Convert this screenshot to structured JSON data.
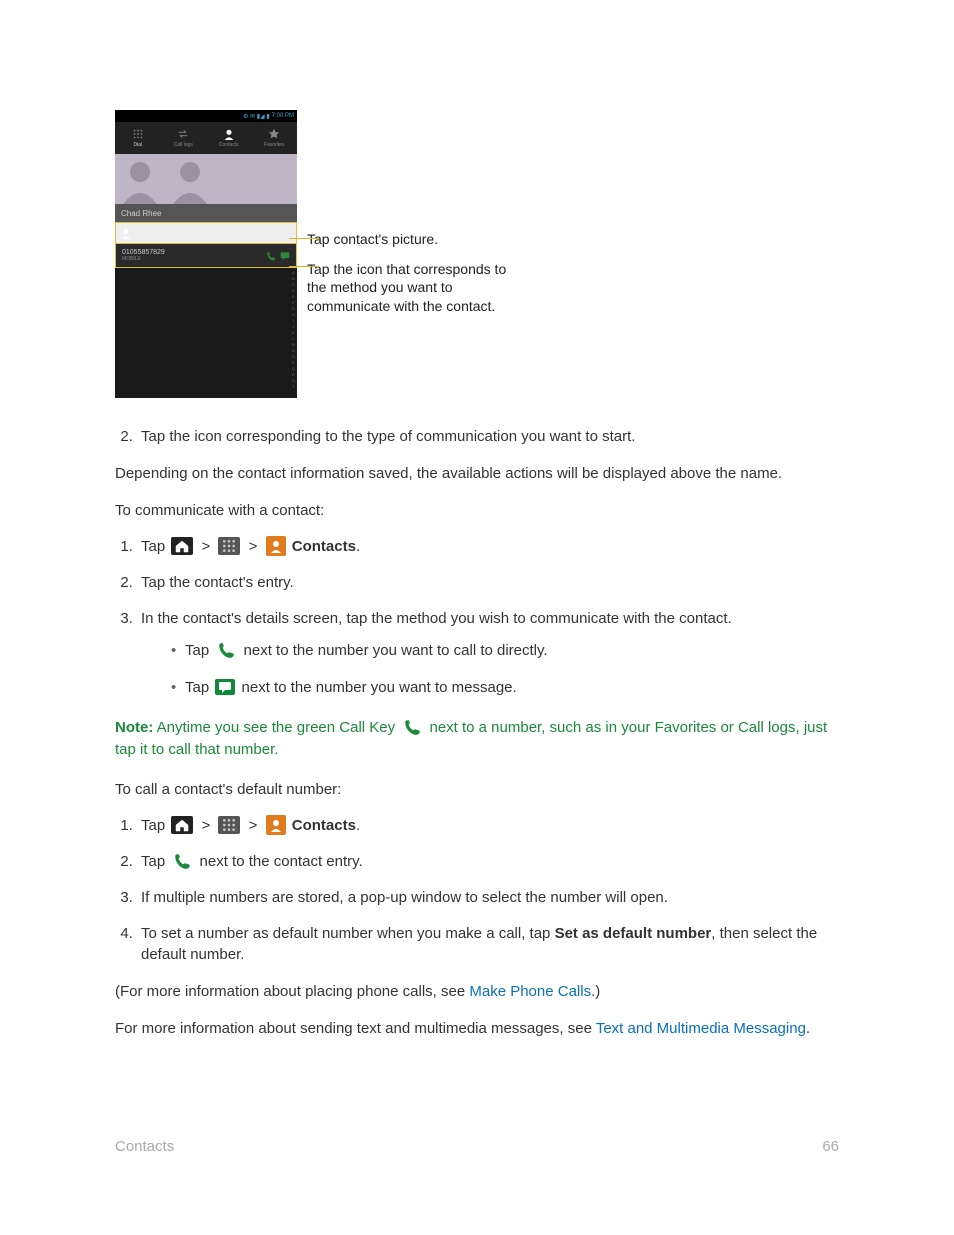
{
  "mockup": {
    "status_time": "7:00 PM",
    "status_icons": "⚙ ✉ ▮◢ ▮",
    "tabs": [
      "Dial",
      "Call logs",
      "Contacts",
      "Favorites"
    ],
    "contact_name": "Chad Rhee",
    "phone_number": "01055857829",
    "phone_label": "MOBILE",
    "callout1": "Tap contact's picture.",
    "callout2": "Tap the icon that corresponds to the method you want to communicate with the contact."
  },
  "steps_top": {
    "item2": "Tap the icon corresponding to the type of communication you want to start."
  },
  "para_depending": "Depending on the contact information saved, the available actions will be displayed above the name.",
  "para_tocomm": "To communicate with a contact:",
  "list_comm": {
    "s1_a": "Tap ",
    "s1_b": "Contacts",
    "s1_c": ".",
    "sep": " > ",
    "s2": "Tap the contact's entry.",
    "s3": "In the contact's details screen, tap the method you wish to communicate with the contact.",
    "b1_a": "Tap ",
    "b1_b": " next to the number you want to call to directly.",
    "b2_a": "Tap ",
    "b2_b": " next to the number you want to message."
  },
  "note": {
    "label": "Note:",
    "a": "  Anytime you see the green Call Key ",
    "b": " next to a number, such as in your Favorites or Call logs, just tap it to call that number."
  },
  "para_default": "To call a contact's default number:",
  "list_default": {
    "s1_a": "Tap ",
    "s1_b": "Contacts",
    "s1_c": ".",
    "sep": " > ",
    "s2_a": "Tap ",
    "s2_b": " next to the contact entry.",
    "s3": "If multiple numbers are stored, a pop-up window to select the number will open.",
    "s4_a": "To set a number as default number when you make a call, tap ",
    "s4_b": "Set as default number",
    "s4_c": ", then select the default number."
  },
  "para_formore1_a": "(For more information about placing phone calls, see ",
  "para_formore1_link": "Make Phone Calls",
  "para_formore1_b": ".)",
  "para_formore2_a": "For more information about sending text and multimedia messages, see ",
  "para_formore2_link": "Text and Multimedia Messaging",
  "para_formore2_b": ".",
  "footer": {
    "section": "Contacts",
    "page": "66"
  }
}
